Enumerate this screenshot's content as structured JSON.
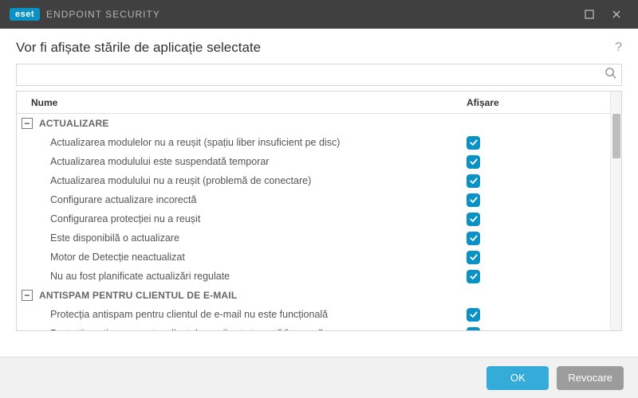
{
  "titlebar": {
    "brand": "eset",
    "product": "ENDPOINT SECURITY"
  },
  "header": {
    "title": "Vor fi afișate stările de aplicație selectate"
  },
  "columns": {
    "name": "Nume",
    "show": "Afișare"
  },
  "groups": [
    {
      "name": "ACTUALIZARE",
      "items": [
        {
          "label": "Actualizarea modulelor nu a reușit (spațiu liber insuficient pe disc)",
          "checked": true
        },
        {
          "label": "Actualizarea modulului este suspendată temporar",
          "checked": true
        },
        {
          "label": "Actualizarea modulului nu a reușit (problemă de conectare)",
          "checked": true
        },
        {
          "label": "Configurare actualizare incorectă",
          "checked": true
        },
        {
          "label": "Configurarea protecției nu a reușit",
          "checked": true
        },
        {
          "label": "Este disponibilă o actualizare",
          "checked": true
        },
        {
          "label": "Motor de Detecție neactualizat",
          "checked": true
        },
        {
          "label": "Nu au fost planificate actualizări regulate",
          "checked": true
        }
      ]
    },
    {
      "name": "ANTISPAM PENTRU CLIENTUL DE E-MAIL",
      "items": [
        {
          "label": "Protecția antispam pentru clientul de e-mail nu este funcțională",
          "checked": true
        },
        {
          "label": "Protecția antispam pentru clientul e-mail este trecută în pauză",
          "checked": true
        }
      ]
    }
  ],
  "footer": {
    "ok": "OK",
    "cancel": "Revocare"
  }
}
